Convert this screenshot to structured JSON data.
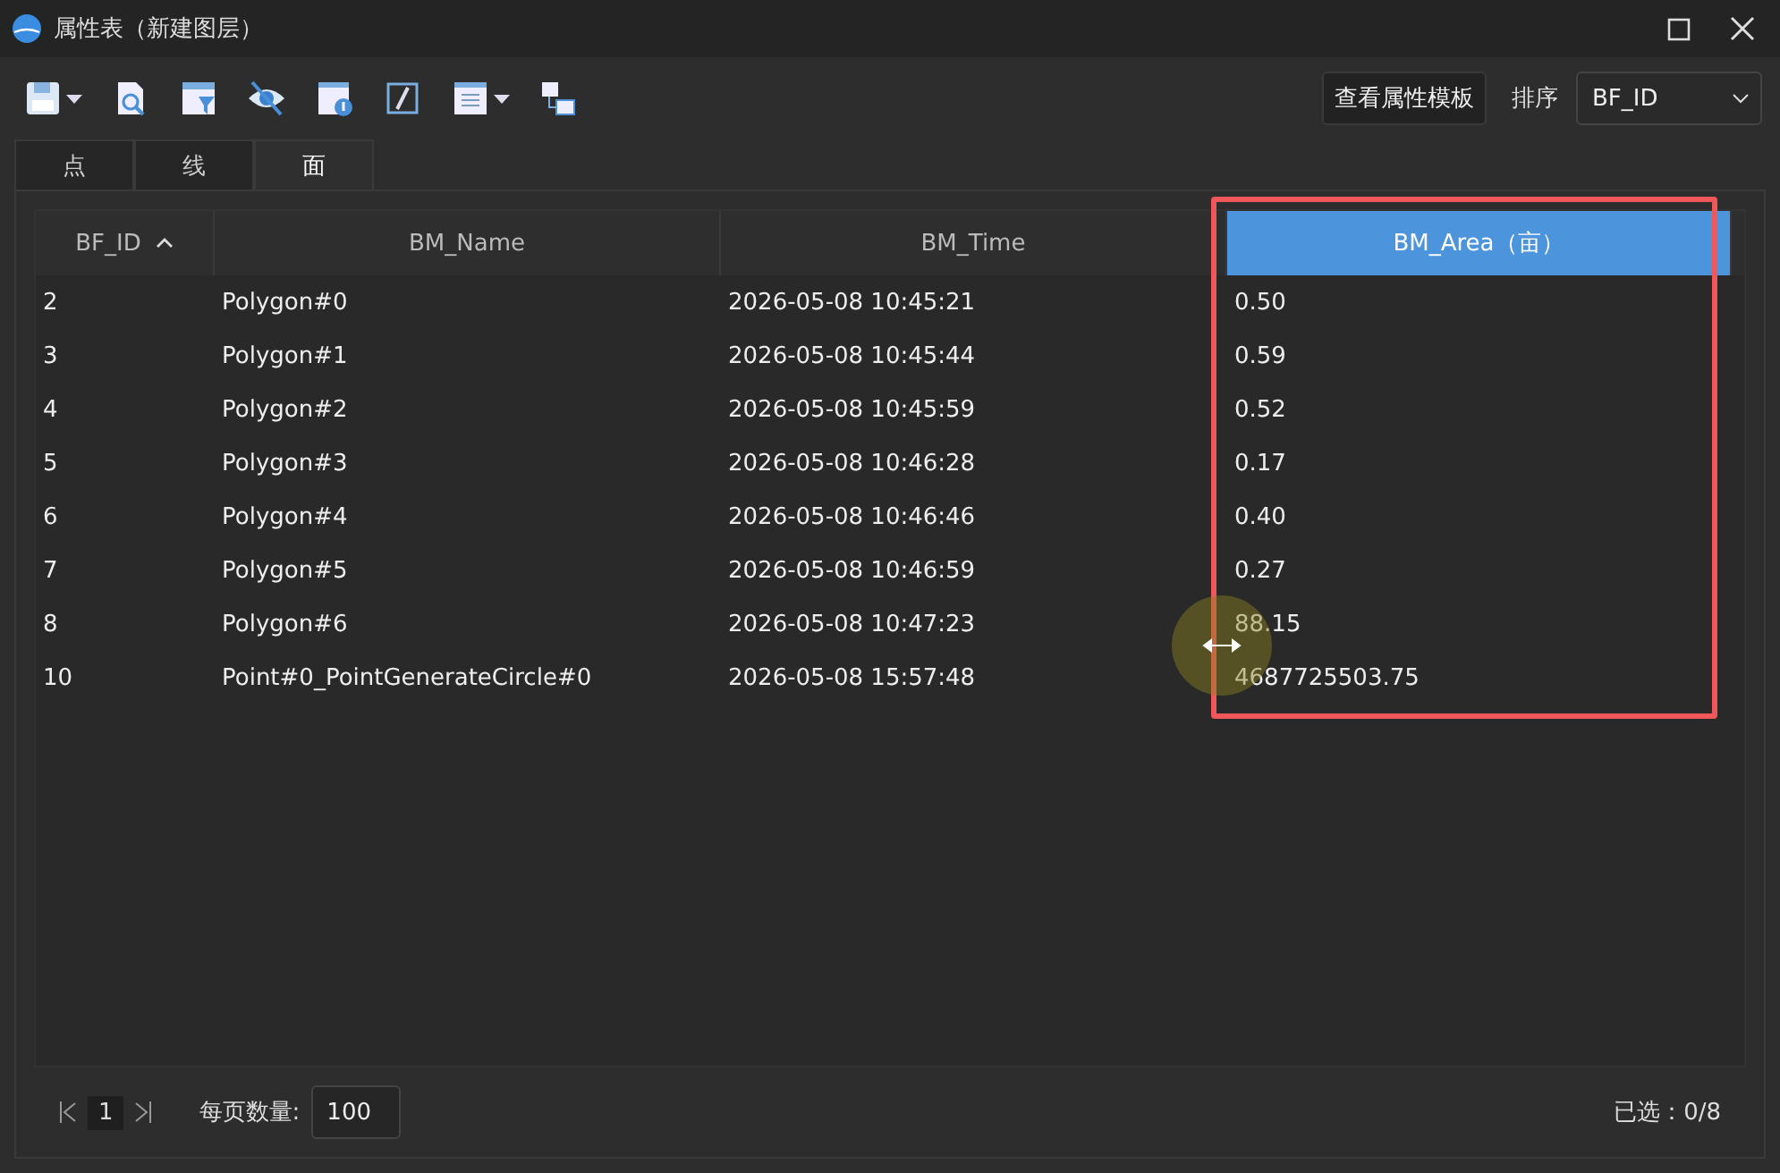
{
  "window": {
    "title": "属性表（新建图层）"
  },
  "toolbar": {
    "template_button": "查看属性模板",
    "sort_label": "排序",
    "sort_value": "BF_ID"
  },
  "tabs": [
    {
      "label": "点",
      "selected": false
    },
    {
      "label": "线",
      "selected": false
    },
    {
      "label": "面",
      "selected": true
    }
  ],
  "table": {
    "columns": [
      {
        "label": "BF_ID",
        "sorted": true,
        "selected": false
      },
      {
        "label": "BM_Name",
        "sorted": false,
        "selected": false
      },
      {
        "label": "BM_Time",
        "sorted": false,
        "selected": false
      },
      {
        "label": "BM_Area（亩）",
        "sorted": false,
        "selected": true
      }
    ],
    "rows": [
      [
        "2",
        "Polygon#0",
        "2026-05-08 10:45:21",
        "0.50"
      ],
      [
        "3",
        "Polygon#1",
        "2026-05-08 10:45:44",
        "0.59"
      ],
      [
        "4",
        "Polygon#2",
        "2026-05-08 10:45:59",
        "0.52"
      ],
      [
        "5",
        "Polygon#3",
        "2026-05-08 10:46:28",
        "0.17"
      ],
      [
        "6",
        "Polygon#4",
        "2026-05-08 10:46:46",
        "0.40"
      ],
      [
        "7",
        "Polygon#5",
        "2026-05-08 10:46:59",
        "0.27"
      ],
      [
        "8",
        "Polygon#6",
        "2026-05-08 10:47:23",
        "88.15"
      ],
      [
        "10",
        "Point#0_PointGenerateCircle#0",
        "2026-05-08 15:57:48",
        "4687725503.75"
      ]
    ]
  },
  "pager": {
    "page": "1",
    "page_size_label": "每页数量:",
    "page_size": "100",
    "selection": "已选：0/8"
  }
}
